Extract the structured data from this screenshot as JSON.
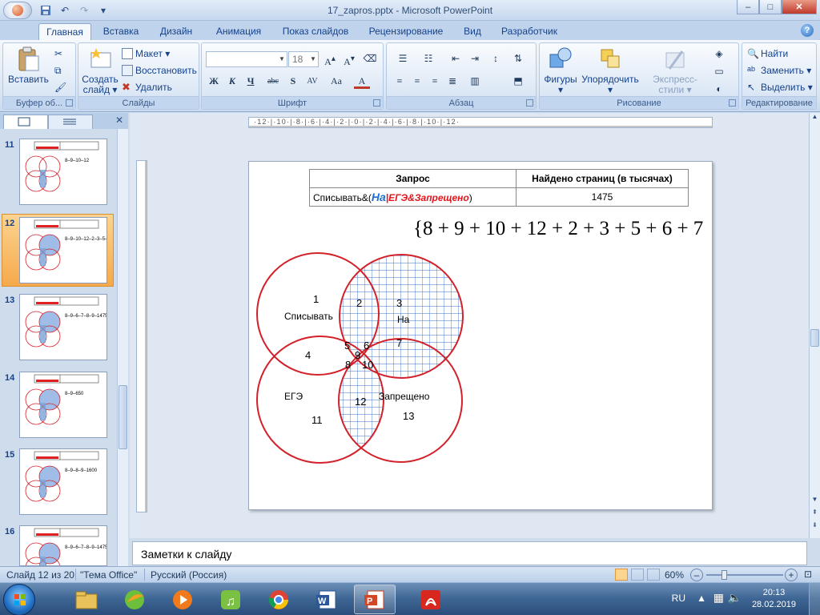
{
  "window": {
    "title": "17_zapros.pptx - Microsoft PowerPoint",
    "controls": {
      "minimize": "–",
      "maximize": "□",
      "close": "✕"
    }
  },
  "qat": {
    "save": "save-icon",
    "undo": "↶",
    "redo": "↷",
    "more": "▾"
  },
  "ribbon_tabs": [
    "Главная",
    "Вставка",
    "Дизайн",
    "Анимация",
    "Показ слайдов",
    "Рецензирование",
    "Вид",
    "Разработчик"
  ],
  "help": "?",
  "groups": {
    "clipboard": {
      "label": "Буфер об...",
      "paste": "Вставить"
    },
    "slides": {
      "label": "Слайды",
      "new_slide": "Создать слайд ▾",
      "layout": "Макет ▾",
      "reset": "Восстановить",
      "delete": "Удалить"
    },
    "font": {
      "label": "Шрифт",
      "font_name": "",
      "font_size": "18",
      "bold": "Ж",
      "italic": "К",
      "underline": "Ч",
      "strike": "abc",
      "shadow": "S",
      "spacing": "AV",
      "case": "Aa",
      "color": "A"
    },
    "paragraph": {
      "label": "Абзац"
    },
    "drawing": {
      "label": "Рисование",
      "shapes": "Фигуры",
      "arrange": "Упорядочить",
      "quick_styles": "Экспресс-стили"
    },
    "editing": {
      "label": "Редактирование",
      "find": "Найти",
      "replace": "Заменить ▾",
      "select": "Выделить ▾"
    }
  },
  "thumbnails": [
    {
      "num": "11",
      "formula": "8–9–10–12"
    },
    {
      "num": "12",
      "formula": "8–9–10–12–2–3–5–6–7"
    },
    {
      "num": "13",
      "formula": "8–9–6–7–8–9–1475"
    },
    {
      "num": "14",
      "formula": "8–9–650"
    },
    {
      "num": "15",
      "formula": "8–9–8–9–1600"
    },
    {
      "num": "16",
      "formula": "8–9–6–7–8–9–1475"
    }
  ],
  "ruler_h": "·12·|·10·|·8·|·6·|·4·|·2·|·0·|·2·|·4·|·6·|·8·|·10·|·12·",
  "slide": {
    "table": {
      "headers": [
        "Запрос",
        "Найдено страниц (в тысячах)"
      ],
      "row_prefix": "Списывать&(",
      "row_blue": "На",
      "row_red": "|ЕГЭ&Запрещено",
      "row_suffix": ")",
      "row_value": "1475"
    },
    "formula": "{8 + 9 + 10 + 12 + 2 + 3 + 5 + 6 + 7",
    "venn": {
      "circles": [
        "Списывать",
        "На",
        "ЕГЭ",
        "Запрещено"
      ],
      "regions": [
        "1",
        "2",
        "3",
        "4",
        "5",
        "6",
        "7",
        "8",
        "9",
        "10",
        "11",
        "12",
        "13"
      ]
    }
  },
  "notes": "Заметки к слайду",
  "status": {
    "slide": "Слайд 12 из 20",
    "theme": "\"Тема Office\"",
    "lang": "Русский (Россия)",
    "zoom": "60%"
  },
  "tray": {
    "lang": "RU",
    "time": "20:13",
    "date": "28.02.2019"
  },
  "colors": {
    "red": "#d3212a",
    "grid": "#3b73c8",
    "accent": "#f6a94a"
  }
}
